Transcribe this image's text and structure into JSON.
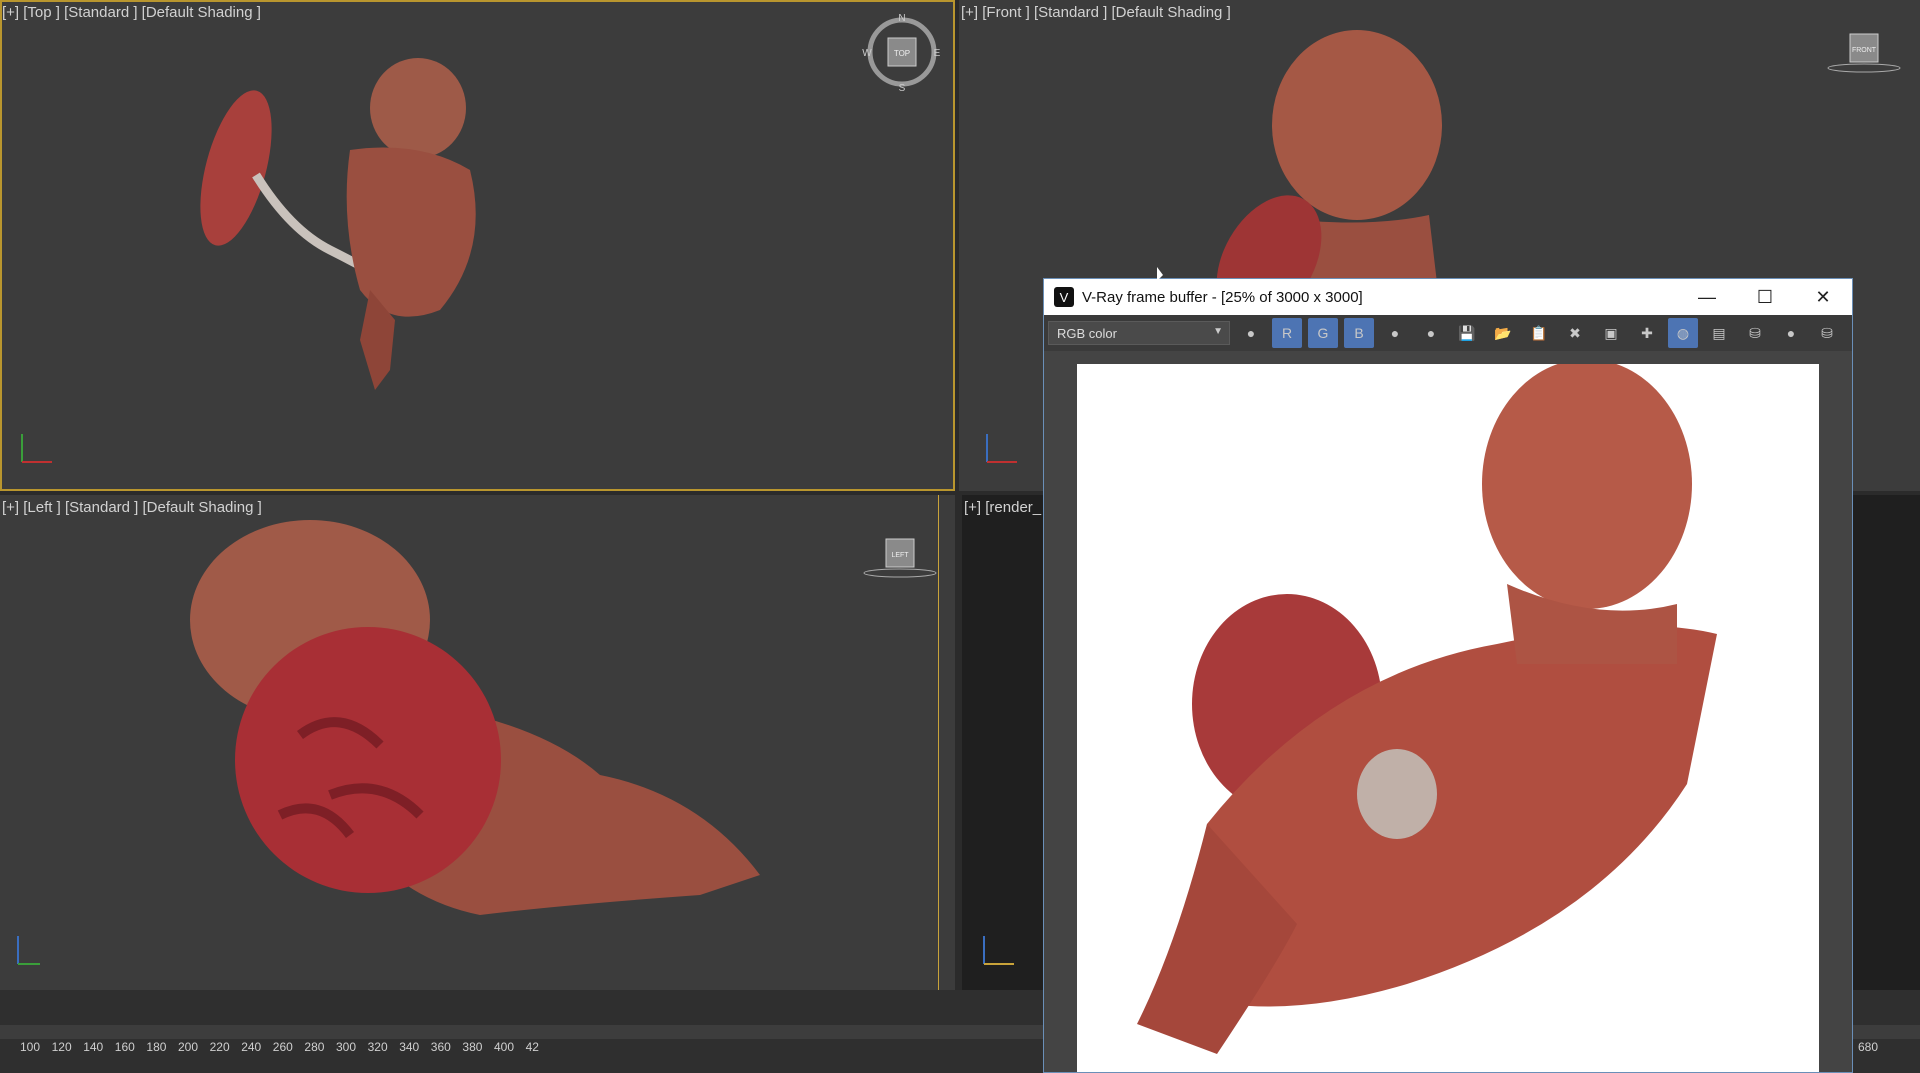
{
  "viewports": {
    "top": {
      "label": "[+] [Top ] [Standard ] [Default Shading ]",
      "cube": "TOP",
      "compass": {
        "n": "N",
        "s": "S",
        "e": "E",
        "w": "W"
      }
    },
    "front": {
      "label": "[+] [Front ] [Standard ] [Default Shading ]",
      "cube": "FRONT"
    },
    "left": {
      "label": "[+] [Left ] [Standard ] [Default Shading ]",
      "cube": "LEFT"
    },
    "render": {
      "label": "[+] [render_"
    }
  },
  "vfb": {
    "title": "V-Ray frame buffer - [25% of 3000 x 3000]",
    "channel": "RGB color",
    "toolbar": [
      {
        "icon": "color-channels-icon",
        "text": "●"
      },
      {
        "icon": "red-channel-icon",
        "text": "R",
        "on": true
      },
      {
        "icon": "green-channel-icon",
        "text": "G",
        "on": true
      },
      {
        "icon": "blue-channel-icon",
        "text": "B",
        "on": true
      },
      {
        "icon": "alpha-icon",
        "text": "●"
      },
      {
        "icon": "mono-icon",
        "text": "●"
      },
      {
        "icon": "save-icon",
        "text": "💾"
      },
      {
        "icon": "open-icon",
        "text": "📂"
      },
      {
        "icon": "clipboard-icon",
        "text": "📋"
      },
      {
        "icon": "clear-icon",
        "text": "✖"
      },
      {
        "icon": "duplicate-icon",
        "text": "▣"
      },
      {
        "icon": "track-mouse-icon",
        "text": "✚"
      },
      {
        "icon": "region-icon",
        "text": "◍",
        "on": true
      },
      {
        "icon": "pixel-info-icon",
        "text": "▤"
      },
      {
        "icon": "render-last-icon",
        "text": "⛁"
      },
      {
        "icon": "stop-icon",
        "text": "●"
      },
      {
        "icon": "render-icon",
        "text": "⛁"
      }
    ]
  },
  "timeline": {
    "ticks": [
      "100",
      "120",
      "140",
      "160",
      "180",
      "200",
      "220",
      "240",
      "260",
      "280",
      "300",
      "320",
      "340",
      "360",
      "380",
      "400",
      "42"
    ],
    "right_tick": "680"
  }
}
